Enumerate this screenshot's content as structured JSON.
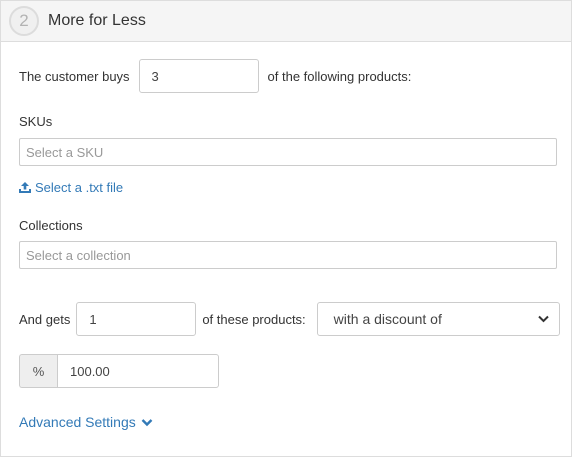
{
  "header": {
    "step_number": "2",
    "title": "More for Less"
  },
  "buys": {
    "prefix": "The customer buys",
    "quantity": "3",
    "suffix": "of the following products:"
  },
  "skus": {
    "label": "SKUs",
    "placeholder": "Select a SKU",
    "upload_link": "Select a .txt file"
  },
  "collections": {
    "label": "Collections",
    "placeholder": "Select a collection"
  },
  "gets": {
    "prefix": "And gets",
    "quantity": "1",
    "middle": "of these products:",
    "discount_type": "with a discount of"
  },
  "discount": {
    "unit": "%",
    "value": "100.00"
  },
  "advanced": {
    "label": "Advanced Settings"
  },
  "colors": {
    "link": "#337ab7",
    "border": "#cccccc",
    "header_bg": "#f5f5f5"
  }
}
